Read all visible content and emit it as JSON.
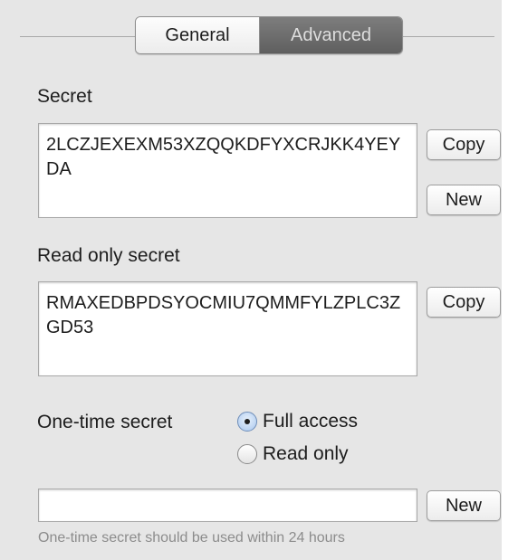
{
  "tabs": [
    {
      "label": "General",
      "selected": false
    },
    {
      "label": "Advanced",
      "selected": true
    }
  ],
  "secret": {
    "label": "Secret",
    "value": "2LCZJEXEXM53XZQQKDFYXCRJKK4YEYDA",
    "copy_label": "Copy",
    "new_label": "New"
  },
  "read_only_secret": {
    "label": "Read only secret",
    "value": "RMAXEDBPDSYOCMIU7QMMFYLZPLC3ZGD53",
    "copy_label": "Copy"
  },
  "one_time_secret": {
    "label": "One-time secret",
    "options": [
      {
        "label": "Full access",
        "selected": true
      },
      {
        "label": "Read only",
        "selected": false
      }
    ],
    "value": "",
    "new_label": "New",
    "hint": "One-time secret should be used within 24 hours"
  }
}
